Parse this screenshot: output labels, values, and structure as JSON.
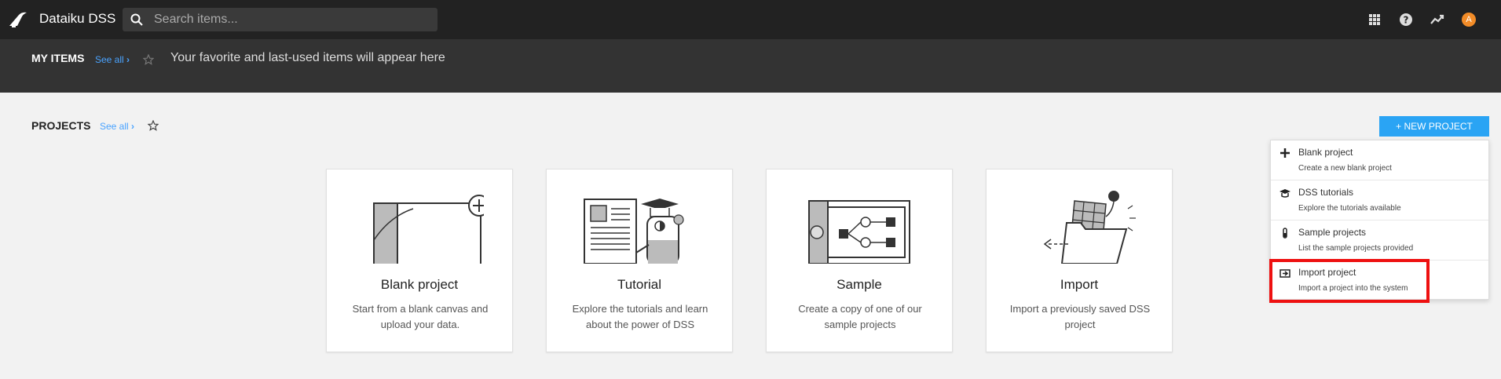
{
  "header": {
    "app_name": "Dataiku DSS",
    "search_placeholder": "Search items...",
    "avatar_initial": "A"
  },
  "my_items": {
    "title": "MY ITEMS",
    "see_all": "See all",
    "message": "Your favorite and last-used items will appear here"
  },
  "projects": {
    "title": "PROJECTS",
    "see_all": "See all",
    "new_project_label": "+ NEW PROJECT"
  },
  "cards": [
    {
      "title": "Blank project",
      "desc": "Start from a blank canvas and upload your data."
    },
    {
      "title": "Tutorial",
      "desc": "Explore the tutorials and learn about the power of DSS"
    },
    {
      "title": "Sample",
      "desc": "Create a copy of one of our sample projects"
    },
    {
      "title": "Import",
      "desc": "Import a previously saved DSS project"
    }
  ],
  "menu": [
    {
      "label": "Blank project",
      "desc": "Create a new blank project",
      "icon": "plus-icon"
    },
    {
      "label": "DSS tutorials",
      "desc": "Explore the tutorials available",
      "icon": "graduation-cap-icon"
    },
    {
      "label": "Sample projects",
      "desc": "List the sample projects provided",
      "icon": "test-tube-icon"
    },
    {
      "label": "Import project",
      "desc": "Import a project into the system",
      "icon": "import-icon"
    }
  ],
  "colors": {
    "topbar": "#222222",
    "banner": "#333333",
    "accent": "#2aa4f4",
    "link": "#4aa3ff",
    "avatar": "#f28c28",
    "highlight": "#ee1111"
  }
}
